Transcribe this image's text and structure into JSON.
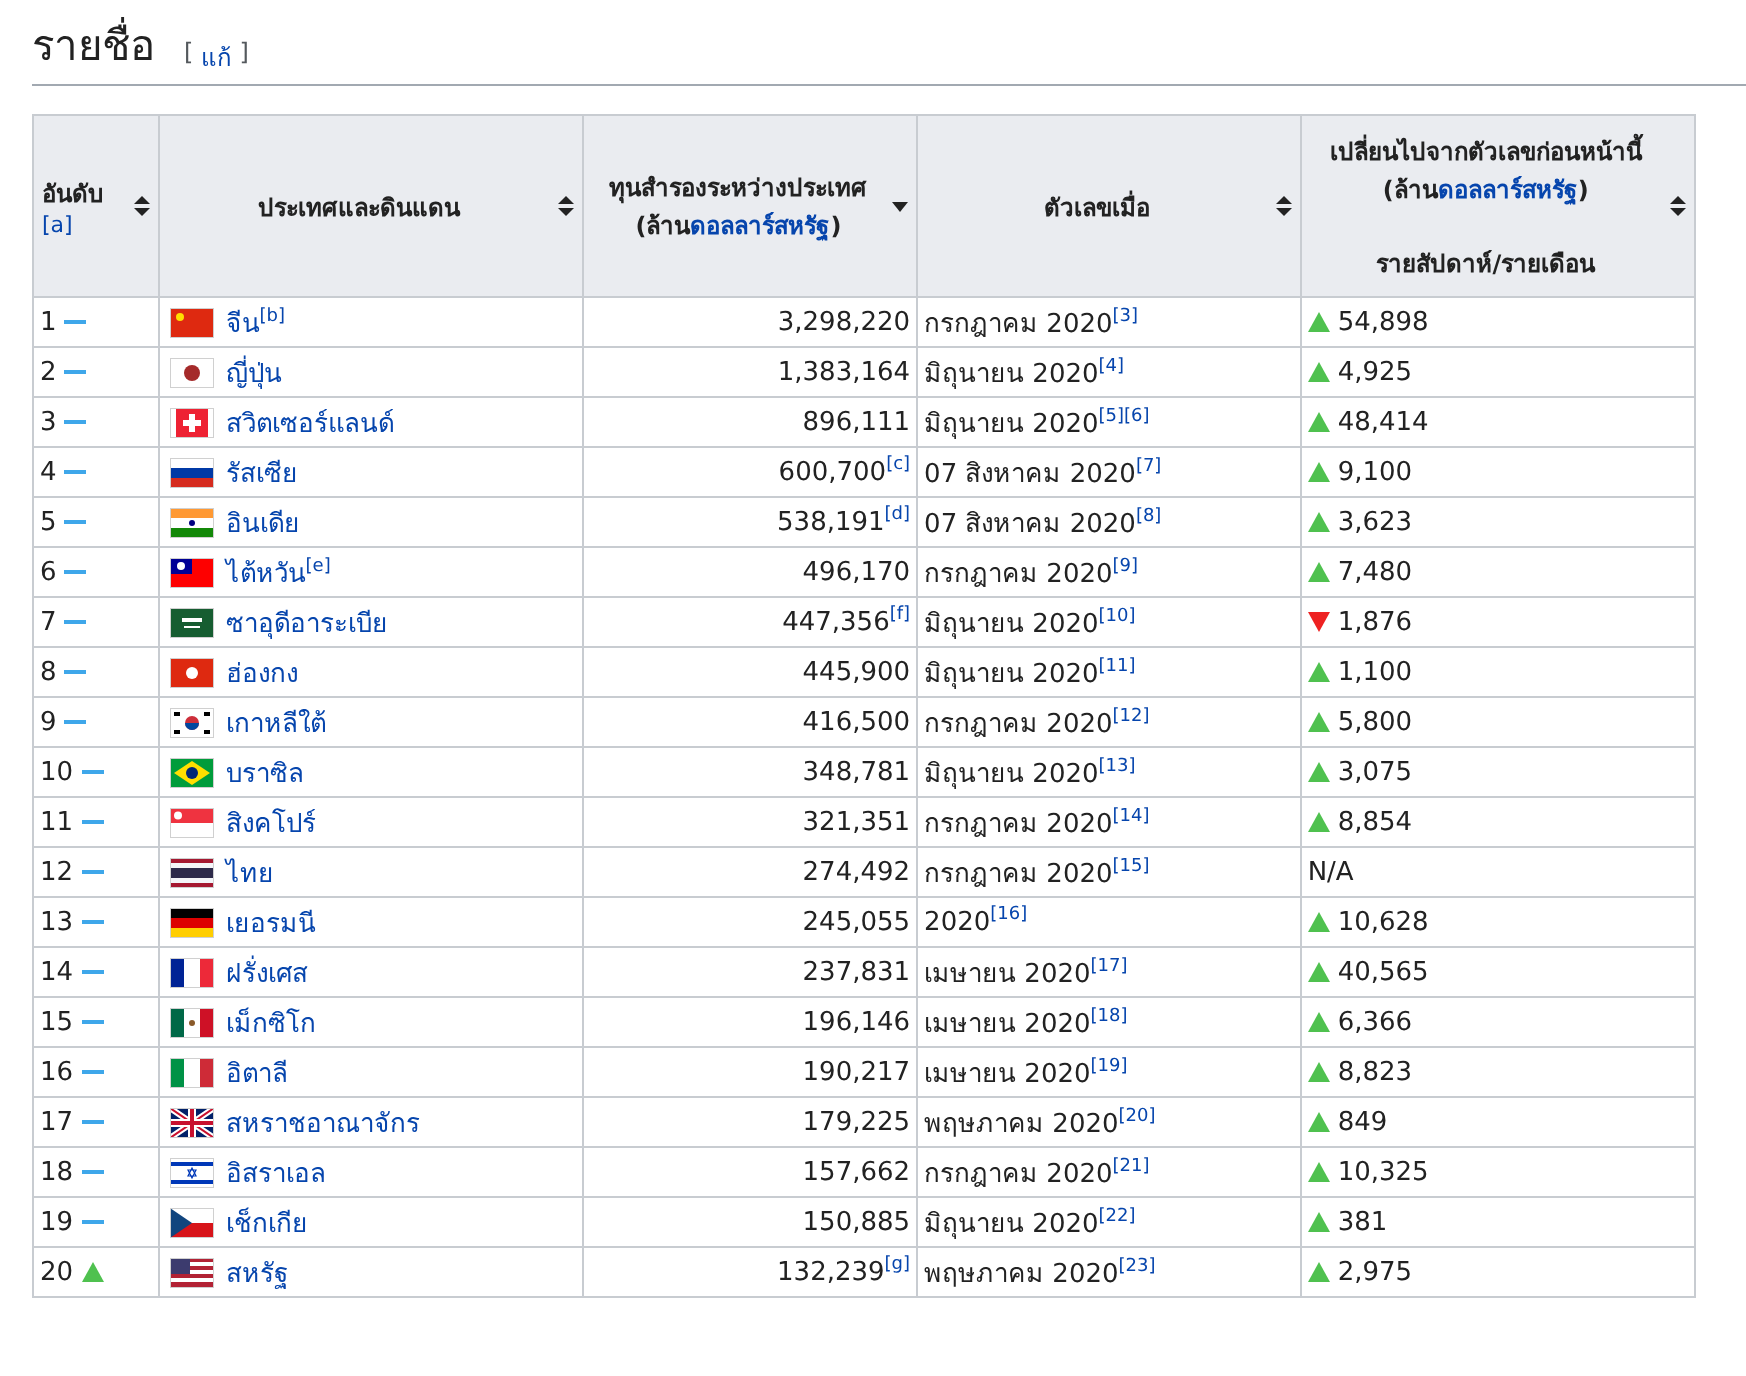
{
  "section": {
    "title": "รายชื่อ",
    "edit_open": "[",
    "edit_link": "แก้",
    "edit_close": "]"
  },
  "table": {
    "columns": [
      {
        "label": "อันดับ",
        "note": "[a]",
        "sorted": false
      },
      {
        "label": "ประเทศและดินแดน",
        "sorted": false
      },
      {
        "label": "ทุนสำรองระหว่างประเทศ",
        "unit_before": "(ล้าน",
        "unit_link": "ดอลลาร์สหรัฐ",
        "unit_after": ")",
        "sorted": true
      },
      {
        "label": "ตัวเลขเมื่อ",
        "sorted": false
      },
      {
        "label": "เปลี่ยนไปจากตัวเลขก่อนหน้านี้",
        "unit_before": "(ล้าน",
        "unit_link": "ดอลลาร์สหรัฐ",
        "unit_after": ")",
        "sub": "รายสัปดาห์/รายเดือน",
        "sorted": false
      }
    ],
    "rows": [
      {
        "rank": "1",
        "rank_up": false,
        "country": "จีน$^{[b]}$",
        "reserves": "3,298,220",
        "as_of": "กรกฎาคม 2020$^{[3]}$",
        "kind": "increase",
        "change": "54,898"
      },
      {
        "rank": "2",
        "rank_up": false,
        "country": "ญี่ปุ่น",
        "reserves": "1,383,164",
        "as_of": "มิถุนายน 2020$^{[4]}$",
        "kind": "increase",
        "change": "4,925"
      },
      {
        "rank": "3",
        "rank_up": false,
        "country": "สวิตเซอร์แลนด์",
        "reserves": "896,111",
        "as_of": "มิถุนายน 2020$^{[5][6]}$",
        "kind": "increase",
        "change": "48,414"
      },
      {
        "rank": "4",
        "rank_up": false,
        "country": "รัสเซีย",
        "reserves": "600,700$^{[c]}$",
        "as_of": "07 สิงหาคม 2020$^{[7]}$",
        "kind": "increase",
        "change": "9,100"
      },
      {
        "rank": "5",
        "rank_up": false,
        "country": "อินเดีย",
        "reserves": "538,191$^{[d]}$",
        "as_of": "07 สิงหาคม 2020$^{[8]}$",
        "kind": "increase",
        "change": "3,623"
      },
      {
        "rank": "6",
        "rank_up": false,
        "country": "ไต้หวัน$^{[e]}$",
        "reserves": "496,170",
        "as_of": "กรกฎาคม 2020$^{[9]}$",
        "kind": "increase",
        "change": "7,480"
      },
      {
        "rank": "7",
        "rank_up": false,
        "country": "ซาอุดีอาระเบีย",
        "reserves": "447,356$^{[f]}$",
        "as_of": "มิถุนายน 2020$^{[10]}$",
        "kind": "decrease",
        "change": "1,876"
      },
      {
        "rank": "8",
        "rank_up": false,
        "country": "ฮ่องกง",
        "reserves": "445,900",
        "as_of": "มิถุนายน 2020$^{[11]}$",
        "kind": "increase",
        "change": "1,100"
      },
      {
        "rank": "9",
        "rank_up": false,
        "country": "เกาหลีใต้",
        "reserves": "416,500",
        "as_of": "กรกฎาคม 2020$^{[12]}$",
        "kind": "increase",
        "change": "5,800"
      },
      {
        "rank": "10",
        "rank_up": false,
        "country": "บราซิล",
        "reserves": "348,781",
        "as_of": "มิถุนายน 2020$^{[13]}$",
        "kind": "increase",
        "change": "3,075"
      },
      {
        "rank": "11",
        "rank_up": false,
        "country": "สิงคโปร์",
        "reserves": "321,351",
        "as_of": "กรกฎาคม 2020$^{[14]}$",
        "kind": "increase",
        "change": "8,854"
      },
      {
        "rank": "12",
        "rank_up": false,
        "country": "ไทย",
        "reserves": "274,492",
        "as_of": "กรกฎาคม 2020$^{[15]}$",
        "kind": "none",
        "change": "N/A"
      },
      {
        "rank": "13",
        "rank_up": false,
        "country": "เยอรมนี",
        "reserves": "245,055",
        "as_of": "2020$^{[16]}$",
        "kind": "increase",
        "change": "10,628"
      },
      {
        "rank": "14",
        "rank_up": false,
        "country": "ฝรั่งเศส",
        "reserves": "237,831",
        "as_of": "เมษายน 2020$^{[17]}$",
        "kind": "increase",
        "change": "40,565"
      },
      {
        "rank": "15",
        "rank_up": false,
        "country": "เม็กซิโก",
        "reserves": "196,146",
        "as_of": "เมษายน 2020$^{[18]}$",
        "kind": "increase",
        "change": "6,366"
      },
      {
        "rank": "16",
        "rank_up": false,
        "country": "อิตาลี",
        "reserves": "190,217",
        "as_of": "เมษายน 2020$^{[19]}$",
        "kind": "increase",
        "change": "8,823"
      },
      {
        "rank": "17",
        "rank_up": false,
        "country": "สหราชอาณาจักร",
        "reserves": "179,225",
        "as_of": "พฤษภาคม 2020$^{[20]}$",
        "kind": "increase",
        "change": "849"
      },
      {
        "rank": "18",
        "rank_up": false,
        "country": "อิสราเอล",
        "reserves": "157,662",
        "as_of": "กรกฎาคม 2020$^{[21]}$",
        "kind": "increase",
        "change": "10,325"
      },
      {
        "rank": "19",
        "rank_up": false,
        "country": "เช็กเกีย",
        "reserves": "150,885",
        "as_of": "มิถุนายน 2020$^{[22]}$",
        "kind": "increase",
        "change": "381"
      },
      {
        "rank": "20",
        "rank_up": true,
        "country": "สหรัฐ",
        "reserves": "132,239$^{[g]}$",
        "as_of": "พฤษภาคม 2020$^{[23]}$",
        "kind": "increase",
        "change": "2,975"
      }
    ]
  }
}
